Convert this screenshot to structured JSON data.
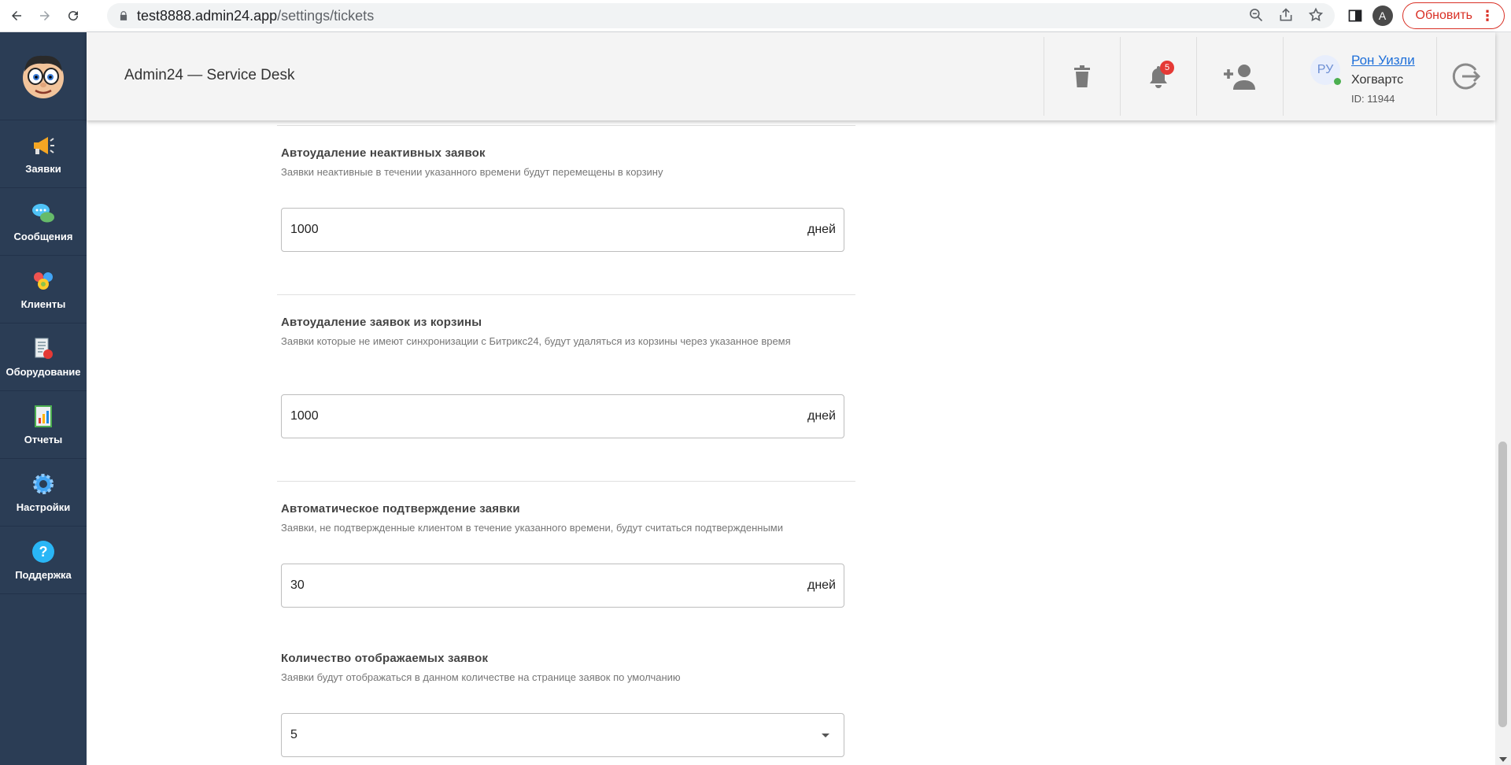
{
  "browser": {
    "url_host": "test8888.admin24.app",
    "url_path": "/settings/tickets",
    "profile_initial": "A",
    "update_label": "Обновить"
  },
  "sidebar": {
    "items": [
      {
        "label": "Заявки",
        "icon": "megaphone-icon"
      },
      {
        "label": "Сообщения",
        "icon": "chat-bubbles-icon"
      },
      {
        "label": "Клиенты",
        "icon": "clients-icon"
      },
      {
        "label": "Оборудование",
        "icon": "equipment-icon"
      },
      {
        "label": "Отчеты",
        "icon": "report-icon"
      },
      {
        "label": "Настройки",
        "icon": "gear-icon"
      },
      {
        "label": "Поддержка",
        "icon": "help-icon"
      }
    ]
  },
  "header": {
    "title": "Admin24 — Service Desk",
    "notifications_count": "5",
    "user": {
      "initials": "РУ",
      "name": "Рон Уизли",
      "org": "Хогвартс",
      "id": "ID: 11944"
    }
  },
  "settings": [
    {
      "title": "Автоудаление неактивных заявок",
      "desc": "Заявки неактивные в течении указанного времени будут перемещены в корзину",
      "value": "1000",
      "unit": "дней"
    },
    {
      "title": "Автоудаление заявок из корзины",
      "desc": "Заявки которые не имеют синхронизации с Битрикс24, будут удаляться из корзины через указанное время",
      "value": "1000",
      "unit": "дней"
    },
    {
      "title": "Автоматическое подтверждение заявки",
      "desc": "Заявки, не подтвержденные клиентом в течение указанного времени, будут считаться подтвержденными",
      "value": "30",
      "unit": "дней"
    },
    {
      "title": "Количество отображаемых заявок",
      "desc": "Заявки будут отображаться в данном количестве на странице заявок по умолчанию",
      "value": "5"
    }
  ],
  "colors": {
    "sidebar_bg": "#2b3d55",
    "header_bg": "#f4f4f4",
    "accent_red": "#d93025",
    "link_blue": "#1e6fd9"
  }
}
